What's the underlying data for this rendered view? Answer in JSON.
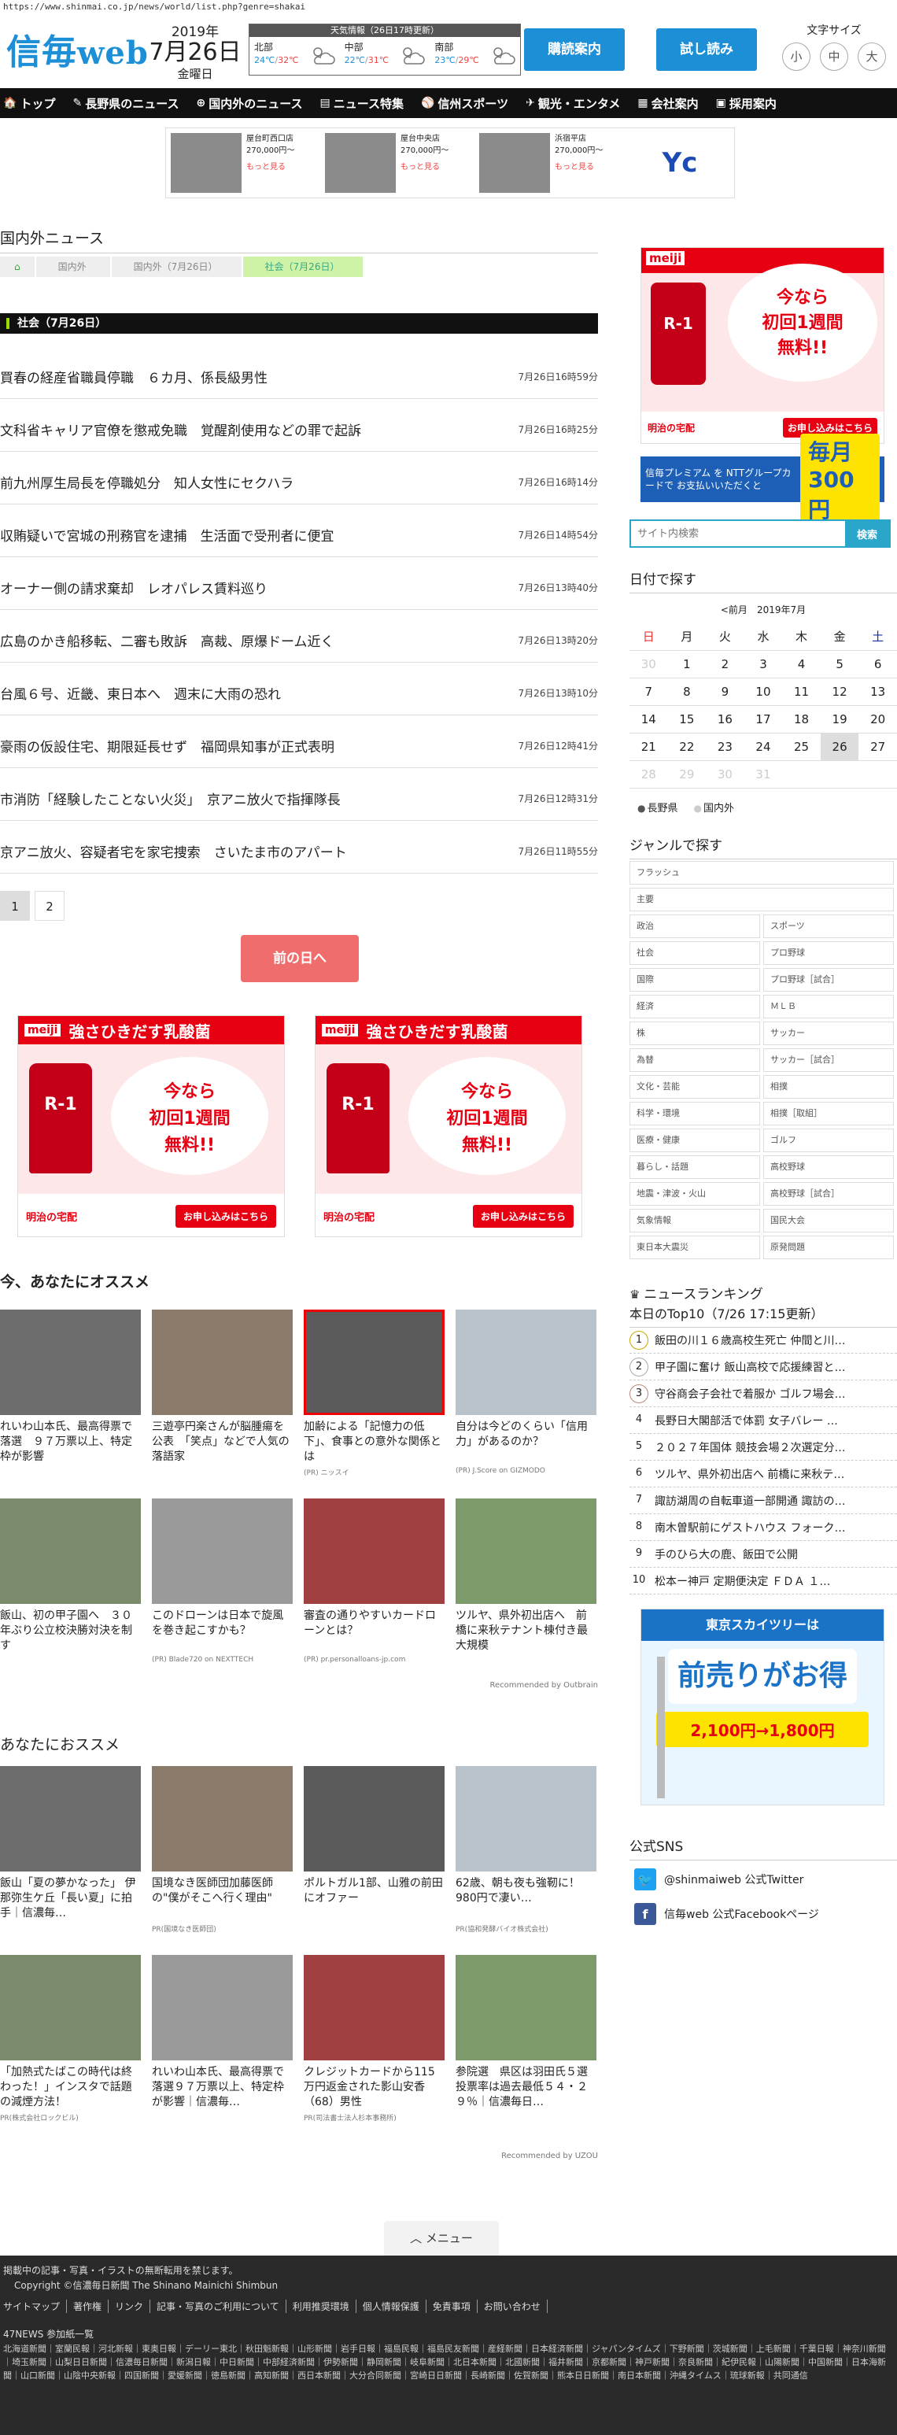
{
  "url": "https://www.shinmai.co.jp/news/world/list.php?genre=shakai",
  "header": {
    "logo_main": "信毎",
    "logo_sub": "web",
    "date_year": "2019年",
    "date_day": "7月26日",
    "date_weekday": "金曜日",
    "weather_title": "天気情報（26日17時更新）",
    "weather": [
      {
        "region": "北部",
        "low": "24℃",
        "high": "32℃",
        "icon": "cloud-sun-icon"
      },
      {
        "region": "中部",
        "low": "22℃",
        "high": "31℃",
        "icon": "cloud-sun-icon"
      },
      {
        "region": "南部",
        "low": "23℃",
        "high": "29℃",
        "icon": "cloud-rain-icon"
      }
    ],
    "subscribe_label": "購読案内",
    "trial_label": "試し読み",
    "fontsize_label": "文字サイズ",
    "fontsize_small": "小",
    "fontsize_mid": "中",
    "fontsize_large": "大"
  },
  "nav": [
    {
      "icon": "🏠",
      "label": "トップ"
    },
    {
      "icon": "✎",
      "label": "長野県のニュース"
    },
    {
      "icon": "⊕",
      "label": "国内外のニュース"
    },
    {
      "icon": "▤",
      "label": "ニュース特集"
    },
    {
      "icon": "⚾",
      "label": "信州スポーツ"
    },
    {
      "icon": "✈",
      "label": "観光・エンタメ"
    },
    {
      "icon": "▦",
      "label": "会社案内"
    },
    {
      "icon": "▣",
      "label": "採用案内"
    }
  ],
  "ad_strip": [
    {
      "title": "屋台町西口店",
      "price": "270,000円～",
      "more": "もっと見る"
    },
    {
      "title": "屋台中央店",
      "price": "270,000円～",
      "more": "もっと見る"
    },
    {
      "title": "浜宿平店",
      "price": "270,000円～",
      "more": "もっと見る"
    }
  ],
  "ad_brand": "Yc",
  "section_title": "国内外ニュース",
  "breadcrumb": [
    "国内外",
    "国内外（7月26日）",
    "社会（7月26日）"
  ],
  "sub_heading": "社会（7月26日）",
  "news": [
    {
      "title": "買春の経産省職員停職　６カ月、係長級男性",
      "time": "7月26日16時59分"
    },
    {
      "title": "文科省キャリア官僚を懲戒免職　覚醒剤使用などの罪で起訴",
      "time": "7月26日16時25分"
    },
    {
      "title": "前九州厚生局長を停職処分　知人女性にセクハラ",
      "time": "7月26日16時14分"
    },
    {
      "title": "収賄疑いで宮城の刑務官を逮捕　生活面で受刑者に便宜",
      "time": "7月26日14時54分"
    },
    {
      "title": "オーナー側の請求棄却　レオパレス賃料巡り",
      "time": "7月26日13時40分"
    },
    {
      "title": "広島のかき船移転、二審も敗訴　高裁、原爆ドーム近く",
      "time": "7月26日13時20分"
    },
    {
      "title": "台風６号、近畿、東日本へ　週末に大雨の恐れ",
      "time": "7月26日13時10分"
    },
    {
      "title": "豪雨の仮設住宅、期限延長せず　福岡県知事が正式表明",
      "time": "7月26日12時41分"
    },
    {
      "title": "市消防「経験したことない火災」　京アニ放火で指揮隊長",
      "time": "7月26日12時31分"
    },
    {
      "title": "京アニ放火、容疑者宅を家宅捜索　さいたま市のアパート",
      "time": "7月26日11時55分"
    }
  ],
  "pager": [
    "1",
    "2"
  ],
  "prev_day_label": "前の日へ",
  "milk_ad": {
    "brand": "meiji",
    "headline": "強さひきだす乳酸菌",
    "bottle": "R-1",
    "offer_line1": "今なら",
    "offer_line2": "初回1週間",
    "offer_line3": "無料!!",
    "store": "明治の宅配",
    "cta": "お申し込みはこちら"
  },
  "rec1_heading": "今、あなたにオススメ",
  "rec1": [
    {
      "caption": "れいわ山本氏、最高得票で落選　９７万票以上、特定枠が影響",
      "source": ""
    },
    {
      "caption": "三遊亭円楽さんが脳腫瘍を公表　「笑点」などで人気の落語家",
      "source": ""
    },
    {
      "caption": "加齢による「記憶力の低下」、食事との意外な関係とは",
      "source": "(PR) ニッスイ"
    },
    {
      "caption": "自分は今どのくらい「信用力」があるのか？",
      "source": "(PR) J.Score on GIZMODO"
    },
    {
      "caption": "飯山、初の甲子園へ　３０年ぶり公立校決勝対決を制す",
      "source": ""
    },
    {
      "caption": "このドローンは日本で旋風を巻き起こすかも？",
      "source": "(PR) Blade720 on NEXTTECH"
    },
    {
      "caption": "審査の通りやすいカードローンとは？",
      "source": "(PR) pr.personalloans-jp.com"
    },
    {
      "caption": "ツルヤ、県外初出店へ　前橋に来秋テナント棟付き最大規模",
      "source": ""
    }
  ],
  "rec1_by": "Recommended by Outbrain",
  "rec2_heading": "あなたにおススメ",
  "rec2": [
    {
      "caption": "飯山「夏の夢かなった」 伊那弥生ケ丘「長い夏」に拍手｜信濃毎…",
      "source": ""
    },
    {
      "caption": "国境なき医師団加藤医師の\"僕がそこへ行く理由\"",
      "source": "PR(国境なき医師団)"
    },
    {
      "caption": "ポルトガル1部、山雅の前田にオファー",
      "source": ""
    },
    {
      "caption": "62歳、朝も夜も強靭に！980円で凄い…",
      "source": "PR(協和発酵バイオ株式会社)"
    },
    {
      "caption": "「加熱式たばこの時代は終わった！」インスタで話題の減煙方法！",
      "source": "PR(株式会社ロックビル)"
    },
    {
      "caption": "れいわ山本氏、最高得票で落選９７万票以上、特定枠が影響｜信濃毎…",
      "source": ""
    },
    {
      "caption": "クレジットカードから115万円返金された影山安香（68）男性",
      "source": "PR(司法書士法人杉本事務所)"
    },
    {
      "caption": "参院選　県区は羽田氏５選　投票率は過去最低５４・２９％｜信濃毎日…",
      "source": ""
    }
  ],
  "rec2_by": "Recommended by UZOU",
  "menu_label": "メニュー",
  "sidebar": {
    "ad2_text": "信毎プレミアム を NTTグループカードで お支払いいただくと",
    "ad2_big": "毎月300円",
    "search_placeholder": "サイト内検索",
    "search_button": "検索",
    "date_heading": "日付で探す",
    "cal_prev": "<前月",
    "cal_month": "2019年7月",
    "weekdays": [
      "日",
      "月",
      "火",
      "水",
      "木",
      "金",
      "土"
    ],
    "cal_rows": [
      [
        "30",
        "1",
        "2",
        "3",
        "4",
        "5",
        "6"
      ],
      [
        "7",
        "8",
        "9",
        "10",
        "11",
        "12",
        "13"
      ],
      [
        "14",
        "15",
        "16",
        "17",
        "18",
        "19",
        "20"
      ],
      [
        "21",
        "22",
        "23",
        "24",
        "25",
        "26",
        "27"
      ],
      [
        "28",
        "29",
        "30",
        "31",
        "",
        "",
        ""
      ]
    ],
    "cal_radio_on": "長野県",
    "cal_radio_off": "国内外",
    "genre_heading": "ジャンルで探す",
    "genres_full": [
      "フラッシュ",
      "主要"
    ],
    "genres": [
      "政治",
      "スポーツ",
      "社会",
      "プロ野球",
      "国際",
      "プロ野球［試合］",
      "経済",
      "ＭＬＢ",
      "株",
      "サッカー",
      "為替",
      "サッカー［試合］",
      "文化・芸能",
      "相撲",
      "科学・環境",
      "相撲［取組］",
      "医療・健康",
      "ゴルフ",
      "暮らし・話題",
      "高校野球",
      "地震・津波・火山",
      "高校野球［試合］",
      "気象情報",
      "国民大会",
      "東日本大震災",
      "原発問題"
    ],
    "ranking_heading": "ニュースランキング",
    "ranking_sub": "本日のTop10（7/26 17:15更新）",
    "ranking": [
      "飯田の川１６歳高校生死亡 仲間と川…",
      "甲子園に奮け 飯山高校で応援練習と…",
      "守谷商会子会社で着服か ゴルフ場会…",
      "長野日大閣部活で体罰 女子バレー …",
      "２０２７年国体 競技会場２次選定分…",
      "ツルヤ、県外初出店へ 前橋に来秋テ…",
      "諏訪湖周の自転車道一部開通 諏訪の…",
      "南木曽駅前にゲストハウス フォーク…",
      "手のひら大の鹿、飯田で公開",
      "松本ー神戸 定期便決定 ＦＤＡ １…"
    ],
    "ad3_head": "東京スカイツリーは",
    "ad3_big": "前売りがお得",
    "ad3_price": "2,100円→1,800円",
    "sns_heading": "公式SNS",
    "sns": [
      {
        "icon": "twitter-icon",
        "glyph": "🐦",
        "color": "#1da1f2",
        "label": "@shinmaiweb 公式Twitter"
      },
      {
        "icon": "facebook-icon",
        "glyph": "f",
        "color": "#3b5998",
        "label": "信毎web 公式Facebookページ"
      }
    ]
  },
  "footer": {
    "line1": "掲載中の記事・写真・イラストの無断転用を禁じます。",
    "line2": "Copyright ©信濃毎日新聞 The Shinano Mainichi Shimbun",
    "links": [
      "サイトマップ",
      "著作権",
      "リンク",
      "記事・写真のご利用について",
      "利用推奨環境",
      "個人情報保護",
      "免責事項",
      "お問い合わせ"
    ],
    "p47_label": "47NEWS 参加紙一覧",
    "papers": "北海道新聞｜室蘭民報｜河北新報｜東奥日報｜デーリー東北｜秋田魁新報｜山形新聞｜岩手日報｜福島民報｜福島民友新聞｜産経新聞｜日本経済新聞｜ジャパンタイムズ｜下野新聞｜茨城新聞｜上毛新聞｜千葉日報｜神奈川新聞｜埼玉新聞｜山梨日日新聞｜信濃毎日新聞｜新潟日報｜中日新聞｜中部経済新聞｜伊勢新聞｜静岡新聞｜岐阜新聞｜北日本新聞｜北國新聞｜福井新聞｜京都新聞｜神戸新聞｜奈良新聞｜紀伊民報｜山陽新聞｜中国新聞｜日本海新聞｜山口新聞｜山陰中央新報｜四国新聞｜愛媛新聞｜徳島新聞｜高知新聞｜西日本新聞｜大分合同新聞｜宮崎日日新聞｜長崎新聞｜佐賀新聞｜熊本日日新聞｜南日本新聞｜沖縄タイムス｜琉球新報｜共同通信"
  }
}
